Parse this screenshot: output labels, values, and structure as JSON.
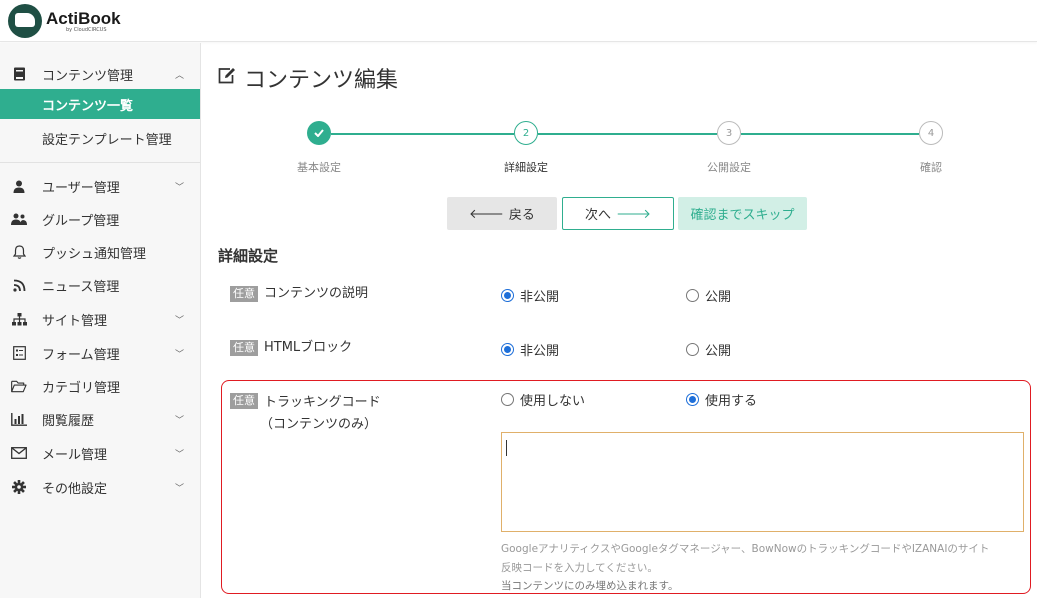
{
  "app": {
    "name": "ActiBook",
    "byline": "by CloudCIRCUS"
  },
  "sidebar": {
    "items": [
      {
        "label": "コンテンツ管理",
        "icon": "book-icon",
        "chevron": "⌃"
      },
      {
        "label": "コンテンツ一覧"
      },
      {
        "label": "設定テンプレート管理"
      },
      {
        "label": "ユーザー管理",
        "icon": "user-icon",
        "chevron": "⌄"
      },
      {
        "label": "グループ管理",
        "icon": "group-icon"
      },
      {
        "label": "プッシュ通知管理",
        "icon": "bell-icon"
      },
      {
        "label": "ニュース管理",
        "icon": "rss-icon"
      },
      {
        "label": "サイト管理",
        "icon": "sitemap-icon",
        "chevron": "⌄"
      },
      {
        "label": "フォーム管理",
        "icon": "form-icon",
        "chevron": "⌄"
      },
      {
        "label": "カテゴリ管理",
        "icon": "folder-icon"
      },
      {
        "label": "閲覧履歴",
        "icon": "bar-chart-icon",
        "chevron": "⌄"
      },
      {
        "label": "メール管理",
        "icon": "mail-icon",
        "chevron": "⌄"
      },
      {
        "label": "その他設定",
        "icon": "gear-icon",
        "chevron": "⌄"
      }
    ]
  },
  "page": {
    "title": "コンテンツ編集"
  },
  "stepper": {
    "steps": [
      {
        "number": "✔",
        "label": "基本設定",
        "state": "done"
      },
      {
        "number": "2",
        "label": "詳細設定",
        "state": "current"
      },
      {
        "number": "3",
        "label": "公開設定",
        "state": "todo"
      },
      {
        "number": "4",
        "label": "確認",
        "state": "todo"
      }
    ],
    "accent": "#2fae8f"
  },
  "actions": {
    "back": "戻る",
    "next": "次へ",
    "skip": "確認までスキップ"
  },
  "section": {
    "title": "詳細設定",
    "tag": "任意",
    "rows": [
      {
        "label": "コンテンツの説明",
        "options": [
          "非公開",
          "公開"
        ],
        "selected": 0
      },
      {
        "label": "HTMLブロック",
        "options": [
          "非公開",
          "公開"
        ],
        "selected": 0
      },
      {
        "label_line1": "トラッキングコード",
        "label_line2": "（コンテンツのみ）",
        "options": [
          "使用しない",
          "使用する"
        ],
        "selected": 1
      }
    ],
    "tracking_value": "",
    "help_line1": "GoogleアナリティクスやGoogleタグマネージャー、BowNowのトラッキングコードやIZANAIのサイト",
    "help_line2": "反映コードを入力してください。",
    "help_line3": "当コンテンツにのみ埋め込まれます。"
  }
}
